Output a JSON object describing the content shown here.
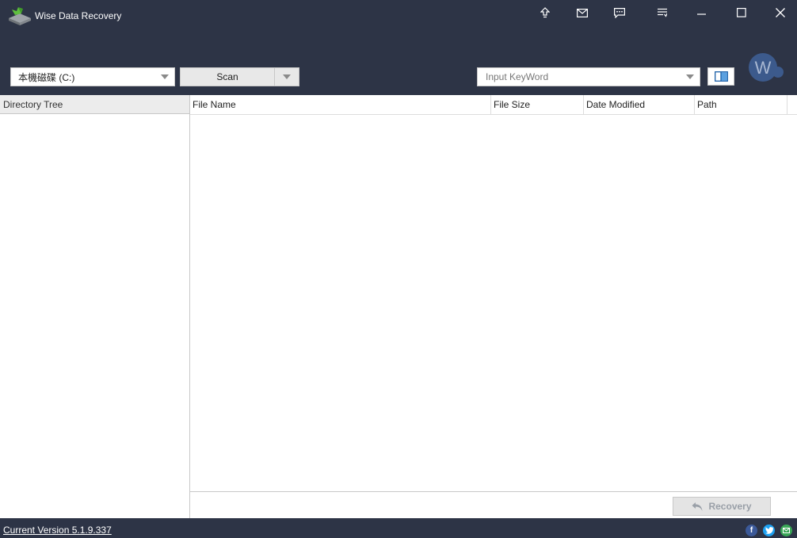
{
  "app": {
    "title": "Wise Data Recovery"
  },
  "titlebar": {
    "icons": [
      "upgrade-icon",
      "mail-icon",
      "feedback-icon",
      "menu-icon",
      "minimize-icon",
      "maximize-icon",
      "close-icon"
    ]
  },
  "toolbar": {
    "drive_value": "本機磁碟 (C:)",
    "scan_label": "Scan",
    "keyword_placeholder": "Input KeyWord",
    "avatar_letter": "W"
  },
  "directory": {
    "header": "Directory Tree"
  },
  "table": {
    "columns": [
      "File Name",
      "File Size",
      "Date Modified",
      "Path"
    ],
    "rows": []
  },
  "footer": {
    "recovery_label": "Recovery",
    "version_text": "Current Version 5.1.9.337",
    "social": [
      "facebook-icon",
      "twitter-icon",
      "email-icon"
    ]
  },
  "colors": {
    "chrome": "#2d3446",
    "avatar": "#3c5a8c",
    "facebook": "#3b5998",
    "twitter": "#1da1f2",
    "email": "#3aa757"
  }
}
